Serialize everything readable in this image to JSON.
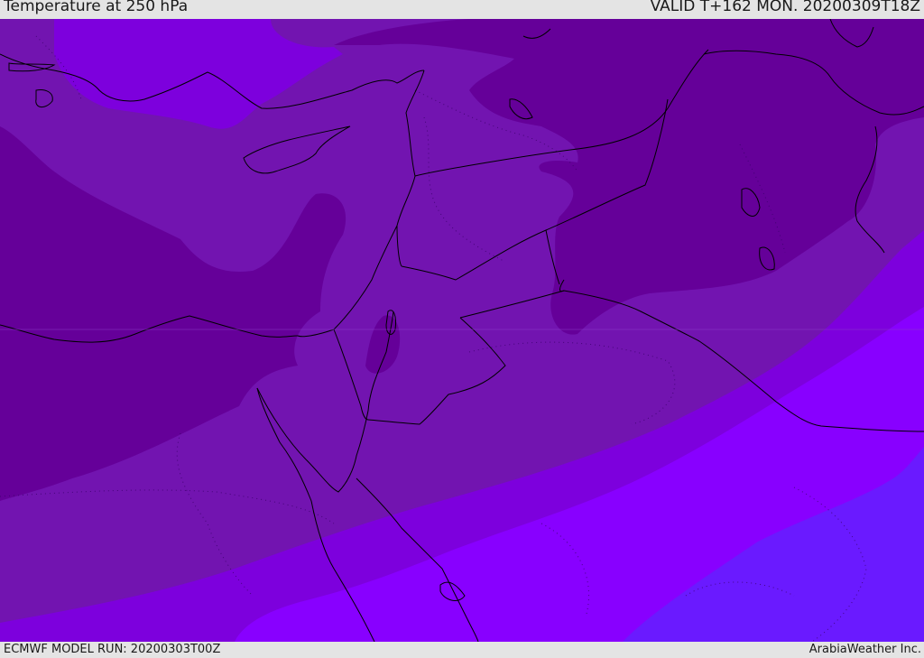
{
  "header": {
    "title": "Temperature at 250 hPa",
    "valid": "VALID T+162 MON. 20200309T18Z"
  },
  "footer": {
    "model_run": "ECMWF MODEL RUN: 20200303T00Z",
    "brand": "ArabiaWeather Inc."
  },
  "map": {
    "colors": {
      "darkest": "#650099",
      "dark": "#7214b0",
      "mid": "#7d00dd",
      "light": "#8800ff",
      "blue": "#6a1aff",
      "coast": "#000000",
      "border": "#000000"
    }
  }
}
